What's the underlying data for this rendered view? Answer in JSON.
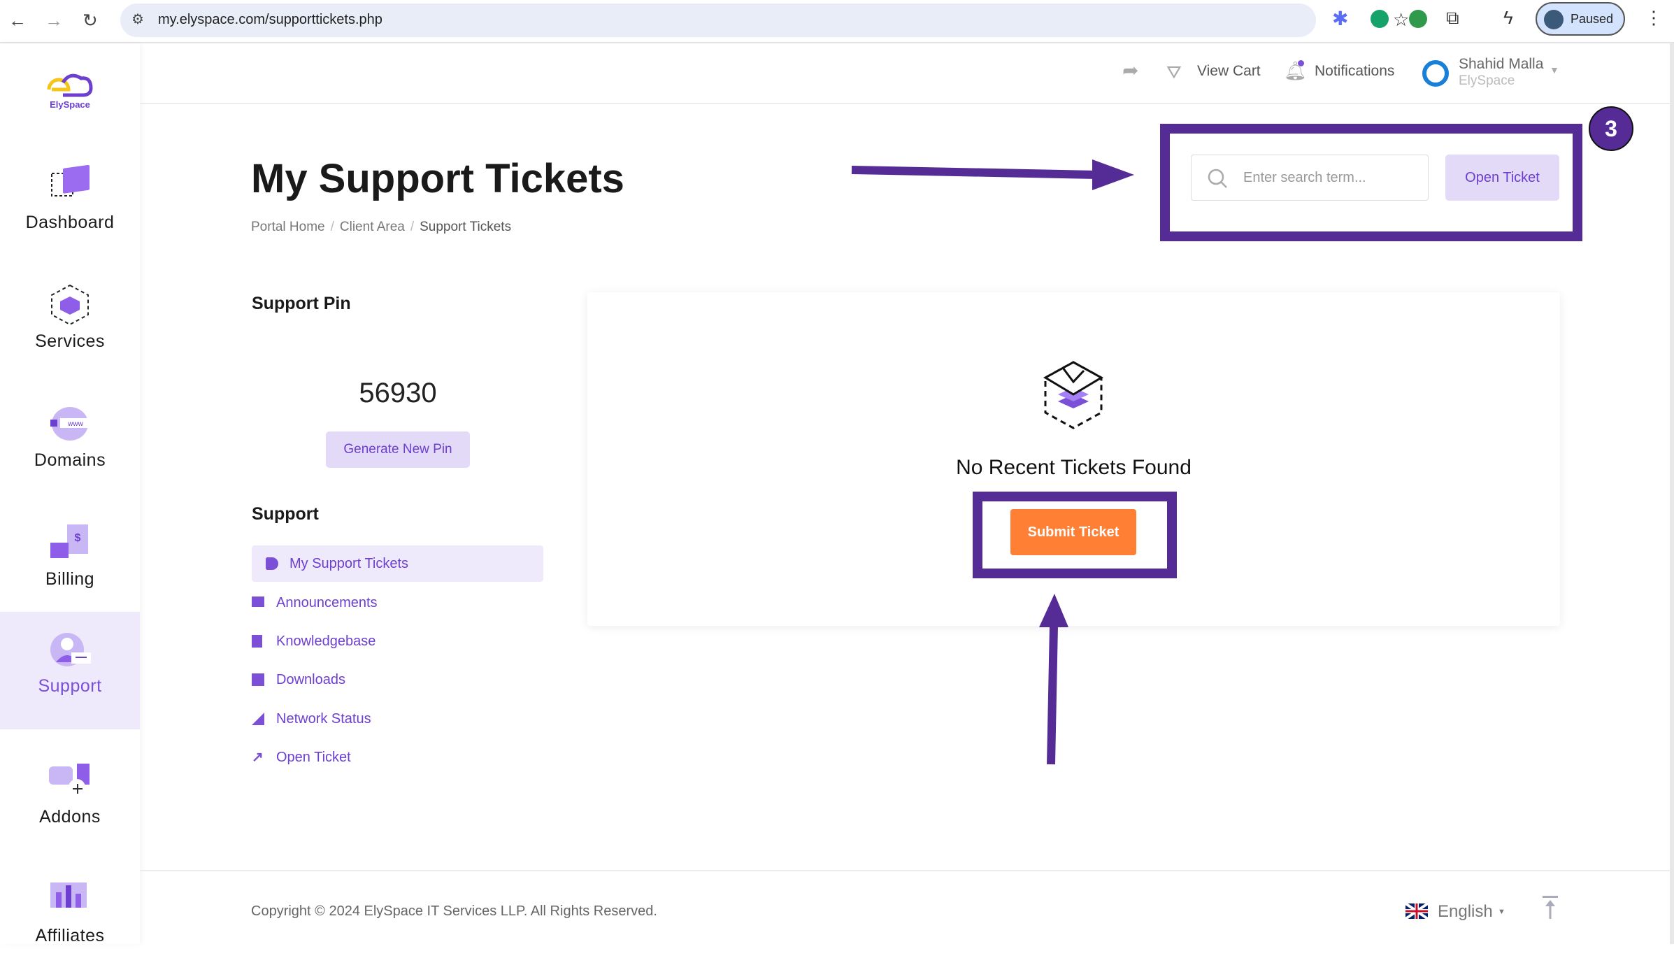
{
  "browser": {
    "url": "my.elyspace.com/supporttickets.php",
    "profile_label": "Paused"
  },
  "logo": {
    "text": "ElySpace"
  },
  "sidebar": {
    "items": [
      {
        "label": "Dashboard",
        "icon": "dashboard-icon"
      },
      {
        "label": "Services",
        "icon": "cube-icon"
      },
      {
        "label": "Domains",
        "icon": "globe-www-icon"
      },
      {
        "label": "Billing",
        "icon": "invoice-icon"
      },
      {
        "label": "Support",
        "icon": "support-agent-icon",
        "active": true
      },
      {
        "label": "Addons",
        "icon": "puzzle-icon"
      },
      {
        "label": "Affiliates",
        "icon": "chart-icon"
      }
    ]
  },
  "topbar": {
    "view_cart": "View Cart",
    "notifications": "Notifications",
    "user_name": "Shahid Malla",
    "user_company": "ElySpace"
  },
  "page": {
    "title": "My Support Tickets",
    "breadcrumb": [
      "Portal Home",
      "Client Area",
      "Support Tickets"
    ]
  },
  "search": {
    "placeholder": "Enter search term...",
    "value": ""
  },
  "open_ticket_button": "Open Ticket",
  "annotation": {
    "step_number": "3",
    "color": "#552b96"
  },
  "support_pin": {
    "heading": "Support Pin",
    "pin": "56930",
    "generate_button": "Generate New Pin"
  },
  "support_menu": {
    "heading": "Support",
    "items": [
      {
        "label": "My Support Tickets",
        "icon": "tag-icon",
        "active": true
      },
      {
        "label": "Announcements",
        "icon": "comment-icon"
      },
      {
        "label": "Knowledgebase",
        "icon": "book-icon"
      },
      {
        "label": "Downloads",
        "icon": "download-icon"
      },
      {
        "label": "Network Status",
        "icon": "signal-icon"
      },
      {
        "label": "Open Ticket",
        "icon": "external-link-icon"
      }
    ]
  },
  "tickets": {
    "empty_message": "No Recent Tickets Found",
    "submit_button": "Submit Ticket"
  },
  "footer": {
    "copyright": "Copyright © 2024 ElySpace IT Services LLP. All Rights Reserved.",
    "language": "English"
  },
  "colors": {
    "accent": "#7b4fd6",
    "submit": "#ff7f35",
    "annotation": "#552b96"
  }
}
